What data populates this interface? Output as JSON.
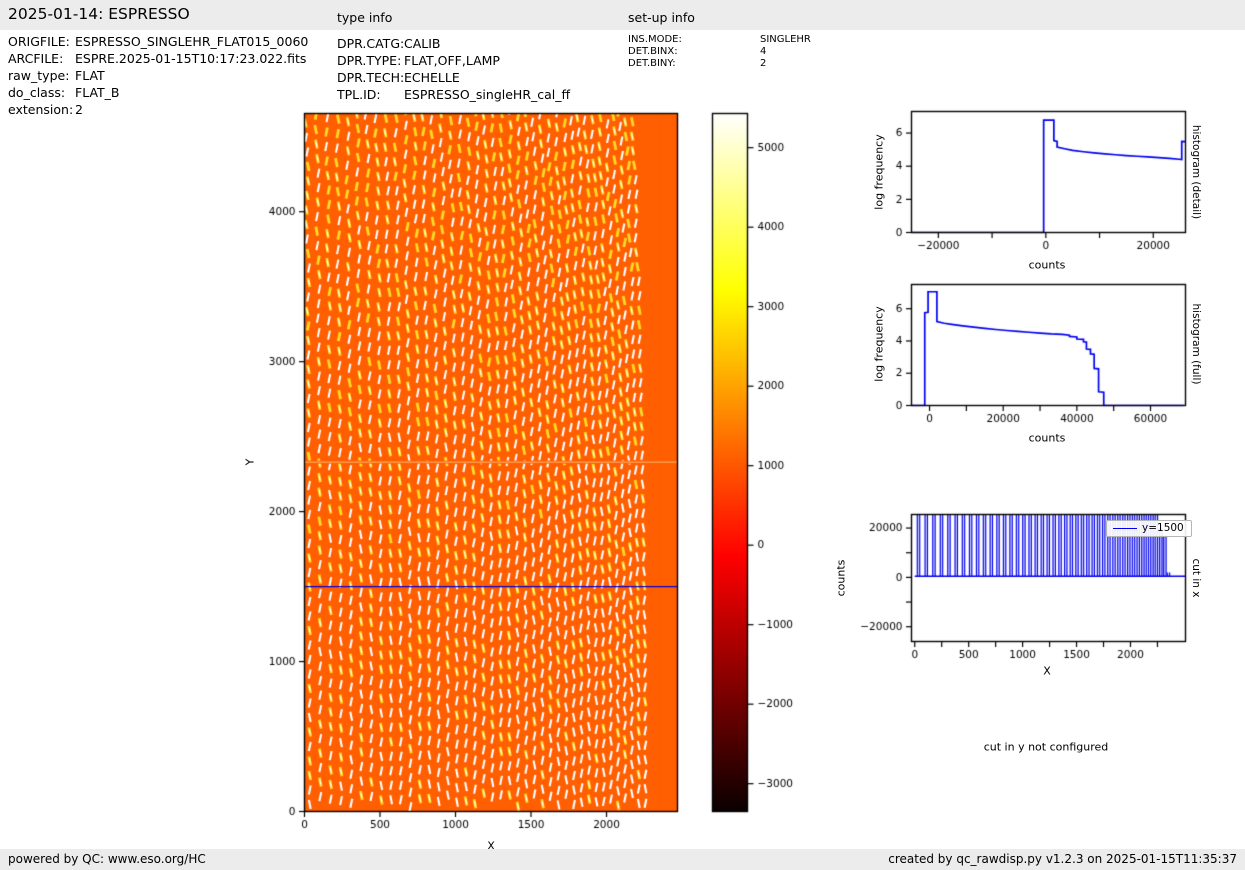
{
  "header": {
    "title": "2025-01-14: ESPRESSO",
    "type_info_heading": "type info",
    "setup_info_heading": "set-up info"
  },
  "file_info": {
    "rows": [
      {
        "label": "ORIGFILE:",
        "value": "ESPRESSO_SINGLEHR_FLAT015_0060"
      },
      {
        "label": "ARCFILE:",
        "value": "ESPRE.2025-01-15T10:17:23.022.fits"
      },
      {
        "label": "raw_type:",
        "value": "FLAT"
      },
      {
        "label": "do_class:",
        "value": "FLAT_B"
      },
      {
        "label": "extension:",
        "value": "2"
      }
    ]
  },
  "type_info": {
    "rows": [
      {
        "label": "DPR.CATG:",
        "value": "CALIB"
      },
      {
        "label": "DPR.TYPE:",
        "value": "FLAT,OFF,LAMP"
      },
      {
        "label": "DPR.TECH:",
        "value": "ECHELLE"
      },
      {
        "label": "TPL.ID:",
        "value": "ESPRESSO_singleHR_cal_ff"
      }
    ]
  },
  "setup_info": {
    "rows": [
      {
        "label": "INS.MODE:",
        "value": "SINGLEHR"
      },
      {
        "label": "DET.BINX:",
        "value": "4"
      },
      {
        "label": "DET.BINY:",
        "value": "2"
      }
    ]
  },
  "note": "cut in y not configured",
  "footer": {
    "left": "powered by QC: www.eso.org/HC",
    "right": "created by qc_rawdisp.py v1.2.3 on 2025-01-15T11:35:37"
  },
  "palette": {
    "band_gray": "#ececec",
    "plot_blue": "#0000ee",
    "image_orange": "#ff5f00",
    "axis_black": "#000000"
  },
  "chart_data": [
    {
      "id": "raw-image",
      "type": "heatmap",
      "xlabel": "X",
      "ylabel": "Y",
      "xlim": [
        0,
        2470
      ],
      "ylim": [
        0,
        4655
      ],
      "xticks": [
        0,
        500,
        1000,
        1500,
        2000
      ],
      "yticks": [
        0,
        1000,
        2000,
        3000,
        4000
      ],
      "background_counts": 1000,
      "background_color": "#ff5f00",
      "n_orders": 40,
      "orders_x_start": 35,
      "overscan_x": 2360,
      "gap_row_y": 2330,
      "cut_line": {
        "y": 1500,
        "color": "#0000dd"
      },
      "stripe_core_color": "#ffffff",
      "stripe_glow_color": "#ffd829"
    },
    {
      "id": "colorbar",
      "type": "colorbar",
      "colormap": "hot",
      "value_range": [
        -3350,
        5430
      ],
      "ticks": [
        5000,
        4000,
        3000,
        2000,
        1000,
        0,
        -1000,
        -2000,
        -3000
      ],
      "gradient_stops": [
        {
          "pos": 0.0,
          "color": "#0a0000"
        },
        {
          "pos": 0.365,
          "color": "#ff0000"
        },
        {
          "pos": 0.746,
          "color": "#ffff00"
        },
        {
          "pos": 1.0,
          "color": "#ffffff"
        }
      ]
    },
    {
      "id": "histogram-detail",
      "type": "line",
      "xlabel": "counts",
      "ylabel": "log frequency",
      "side_label": "histogram (detail)",
      "line_color": "#0000ee",
      "xlim": [
        -25000,
        26000
      ],
      "ylim": [
        0,
        7.3
      ],
      "xticks": [
        -20000,
        0,
        20000
      ],
      "xticks_unlabeled": [
        -10000,
        10000
      ],
      "yticks": [
        0,
        2,
        4,
        6
      ],
      "points": [
        [
          -25000,
          0
        ],
        [
          -400,
          0
        ],
        [
          -400,
          6.78
        ],
        [
          1500,
          6.78
        ],
        [
          1500,
          5.55
        ],
        [
          2100,
          5.5
        ],
        [
          2100,
          5.15
        ],
        [
          3500,
          5.05
        ],
        [
          5000,
          4.95
        ],
        [
          7000,
          4.87
        ],
        [
          9000,
          4.8
        ],
        [
          11000,
          4.74
        ],
        [
          13000,
          4.69
        ],
        [
          15000,
          4.64
        ],
        [
          17000,
          4.6
        ],
        [
          19000,
          4.56
        ],
        [
          21000,
          4.52
        ],
        [
          23000,
          4.47
        ],
        [
          24800,
          4.42
        ],
        [
          25300,
          4.4
        ],
        [
          25300,
          5.5
        ],
        [
          26000,
          5.48
        ]
      ]
    },
    {
      "id": "histogram-full",
      "type": "line",
      "xlabel": "counts",
      "ylabel": "log frequency",
      "side_label": "histogram (full)",
      "line_color": "#0000ee",
      "xlim": [
        -4900,
        69500
      ],
      "ylim": [
        0,
        7.5
      ],
      "xticks": [
        0,
        20000,
        40000,
        60000
      ],
      "xticks_unlabeled": [
        10000,
        30000,
        50000
      ],
      "yticks": [
        0,
        2,
        4,
        6
      ],
      "points": [
        [
          -4900,
          0
        ],
        [
          -1300,
          0
        ],
        [
          -1300,
          5.75
        ],
        [
          -400,
          5.78
        ],
        [
          -400,
          7.05
        ],
        [
          2000,
          7.05
        ],
        [
          2000,
          5.2
        ],
        [
          4000,
          5.1
        ],
        [
          6000,
          5.03
        ],
        [
          9000,
          4.94
        ],
        [
          12000,
          4.86
        ],
        [
          15000,
          4.78
        ],
        [
          18000,
          4.71
        ],
        [
          21000,
          4.65
        ],
        [
          24000,
          4.59
        ],
        [
          27000,
          4.54
        ],
        [
          30000,
          4.49
        ],
        [
          33000,
          4.44
        ],
        [
          36000,
          4.41
        ],
        [
          38000,
          4.36
        ],
        [
          38000,
          4.28
        ],
        [
          40000,
          4.25
        ],
        [
          40000,
          4.12
        ],
        [
          41800,
          4.1
        ],
        [
          41800,
          3.95
        ],
        [
          42600,
          3.93
        ],
        [
          42600,
          3.5
        ],
        [
          43700,
          3.48
        ],
        [
          43700,
          3.2
        ],
        [
          44700,
          3.18
        ],
        [
          44700,
          2.3
        ],
        [
          45900,
          2.27
        ],
        [
          45900,
          0.85
        ],
        [
          47300,
          0.82
        ],
        [
          47300,
          0
        ],
        [
          69000,
          0
        ]
      ]
    },
    {
      "id": "cut-in-x",
      "type": "spikes",
      "xlabel": "X",
      "ylabel": "counts",
      "side_label": "cut in x",
      "legend_label": "y=1500",
      "line_color": "#0000ee",
      "xlim": [
        -30,
        2510
      ],
      "ylim": [
        -26000,
        25500
      ],
      "xticks": [
        0,
        500,
        1000,
        1500,
        2000
      ],
      "xticks_unlabeled": [
        250,
        750,
        1250,
        1750,
        2250
      ],
      "yticks": [
        -20000,
        0,
        20000
      ],
      "yticks_unlabeled": [
        -10000,
        10000
      ],
      "baseline": 500,
      "spikes": [
        [
          35,
          29000
        ],
        [
          107,
          29000
        ],
        [
          178,
          29000
        ],
        [
          248,
          29000
        ],
        [
          317,
          29000
        ],
        [
          385,
          29000
        ],
        [
          452,
          29000
        ],
        [
          518,
          29000
        ],
        [
          583,
          29000
        ],
        [
          647,
          29000
        ],
        [
          710,
          29000
        ],
        [
          772,
          29000
        ],
        [
          833,
          29000
        ],
        [
          893,
          29000
        ],
        [
          953,
          29000
        ],
        [
          1012,
          29000
        ],
        [
          1070,
          29000
        ],
        [
          1127,
          29000
        ],
        [
          1183,
          29000
        ],
        [
          1238,
          29000
        ],
        [
          1293,
          29000
        ],
        [
          1347,
          29000
        ],
        [
          1400,
          29000
        ],
        [
          1452,
          29000
        ],
        [
          1504,
          29000
        ],
        [
          1555,
          29000
        ],
        [
          1605,
          29000
        ],
        [
          1655,
          29000
        ],
        [
          1704,
          29000
        ],
        [
          1752,
          29000
        ],
        [
          1800,
          29000
        ],
        [
          1847,
          29000
        ],
        [
          1893,
          29000
        ],
        [
          1939,
          29000
        ],
        [
          1984,
          29000
        ],
        [
          2028,
          29000
        ],
        [
          2072,
          29000
        ],
        [
          2115,
          29000
        ],
        [
          2157,
          29000
        ],
        [
          2199,
          29000
        ],
        [
          2240,
          29000
        ],
        [
          2281,
          20000
        ],
        [
          2319,
          17000
        ],
        [
          2352,
          2000
        ]
      ]
    }
  ]
}
